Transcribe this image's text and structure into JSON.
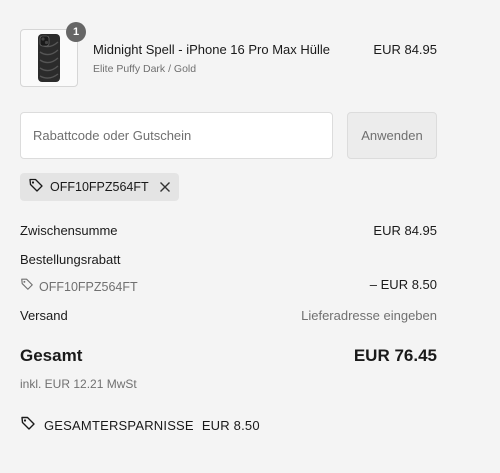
{
  "product": {
    "quantity": "1",
    "title": "Midnight Spell - iPhone 16 Pro Max Hülle",
    "variant": "Elite Puffy Dark / Gold",
    "price": "EUR 84.95"
  },
  "discount": {
    "placeholder": "Rabattcode oder Gutschein",
    "value": "",
    "apply_label": "Anwenden",
    "applied_code": "OFF10FPZ564FT"
  },
  "summary": {
    "subtotal_label": "Zwischensumme",
    "subtotal_value": "EUR 84.95",
    "order_discount_label": "Bestellungsrabatt",
    "order_discount_code": "OFF10FPZ564FT",
    "order_discount_value": "– EUR 8.50",
    "shipping_label": "Versand",
    "shipping_value": "Lieferadresse eingeben",
    "total_label": "Gesamt",
    "total_value": "EUR 76.45",
    "tax_note": "inkl. EUR 12.21 MwSt",
    "savings_label": "GESAMTERSPARNISSE",
    "savings_value": "EUR 8.50"
  }
}
